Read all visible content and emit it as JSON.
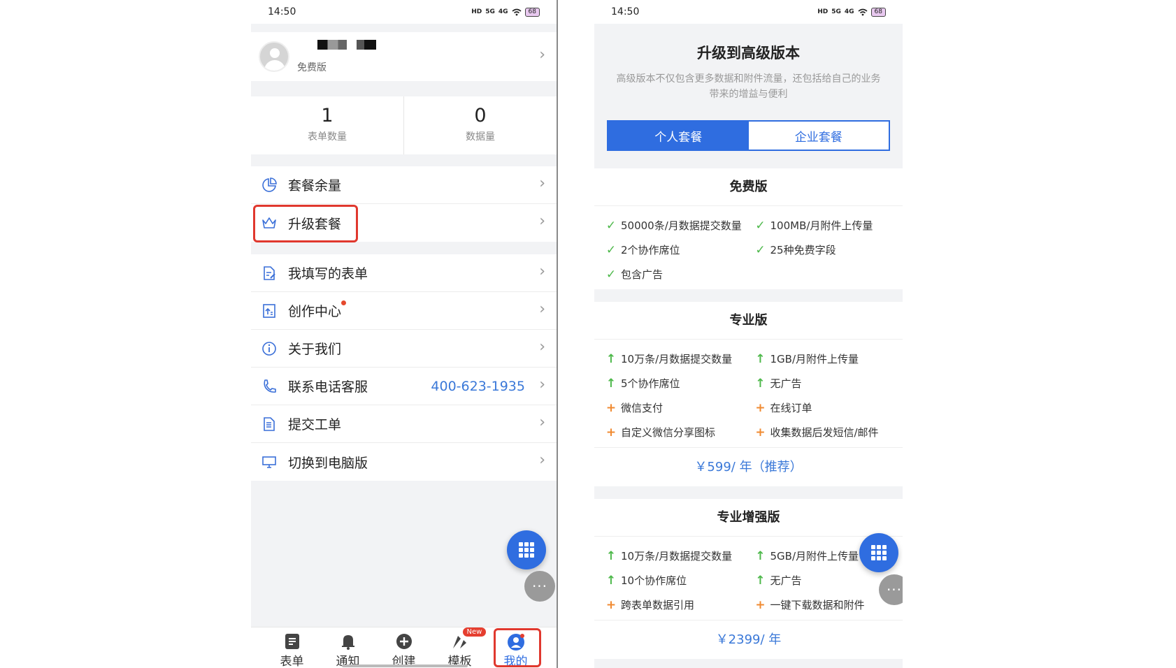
{
  "left": {
    "status": {
      "time": "14:50",
      "net1": "HD",
      "net2": "5G",
      "net3": "4G",
      "battery": "68"
    },
    "profile": {
      "plan": "免费版"
    },
    "stats": [
      {
        "value": "1",
        "label": "表单数量"
      },
      {
        "value": "0",
        "label": "数据量"
      }
    ],
    "menu1": [
      {
        "label": "套餐余量"
      },
      {
        "label": "升级套餐"
      }
    ],
    "menu2": [
      {
        "label": "我填写的表单"
      },
      {
        "label": "创作中心"
      },
      {
        "label": "关于我们"
      },
      {
        "label": "联系电话客服",
        "value": "400-623-1935"
      },
      {
        "label": "提交工单"
      },
      {
        "label": "切换到电脑版"
      }
    ],
    "tabbar": [
      {
        "label": "表单",
        "icon": "form-icon"
      },
      {
        "label": "通知",
        "icon": "bell-icon"
      },
      {
        "label": "创建",
        "icon": "plus-icon"
      },
      {
        "label": "模板",
        "icon": "template-icon",
        "badge": "New"
      },
      {
        "label": "我的",
        "icon": "user-icon"
      }
    ]
  },
  "right": {
    "status": {
      "time": "14:50",
      "net1": "HD",
      "net2": "5G",
      "net3": "4G",
      "battery": "68"
    },
    "title": "升级到高级版本",
    "desc": "高级版本不仅包含更多数据和附件流量，还包括给自己的业务带来的增益与便利",
    "tabs": [
      "个人套餐",
      "企业套餐"
    ],
    "plans": [
      {
        "name": "免费版",
        "features": [
          {
            "icon": "check",
            "text": "50000条/月数据提交数量"
          },
          {
            "icon": "check",
            "text": "100MB/月附件上传量"
          },
          {
            "icon": "check",
            "text": "2个协作席位"
          },
          {
            "icon": "check",
            "text": "25种免费字段"
          },
          {
            "icon": "check",
            "text": "包含广告"
          }
        ]
      },
      {
        "name": "专业版",
        "features": [
          {
            "icon": "up",
            "text": "10万条/月数据提交数量"
          },
          {
            "icon": "up",
            "text": "1GB/月附件上传量"
          },
          {
            "icon": "up",
            "text": "5个协作席位"
          },
          {
            "icon": "up",
            "text": "无广告"
          },
          {
            "icon": "plus",
            "text": "微信支付"
          },
          {
            "icon": "plus",
            "text": "在线订单"
          },
          {
            "icon": "plus",
            "text": "自定义微信分享图标"
          },
          {
            "icon": "plus",
            "text": "收集数据后发短信/邮件"
          }
        ],
        "price": "￥599/ 年（推荐）"
      },
      {
        "name": "专业增强版",
        "features": [
          {
            "icon": "up",
            "text": "10万条/月数据提交数量"
          },
          {
            "icon": "up",
            "text": "5GB/月附件上传量"
          },
          {
            "icon": "up",
            "text": "10个协作席位"
          },
          {
            "icon": "up",
            "text": "无广告"
          },
          {
            "icon": "plus",
            "text": "跨表单数据引用"
          },
          {
            "icon": "plus",
            "text": "一键下载数据和附件"
          }
        ],
        "price": "￥2399/ 年"
      }
    ]
  },
  "colors": {
    "accent": "#2f6de0",
    "highlight": "#e0382e",
    "check": "#4db84a",
    "plus": "#f08a30"
  }
}
